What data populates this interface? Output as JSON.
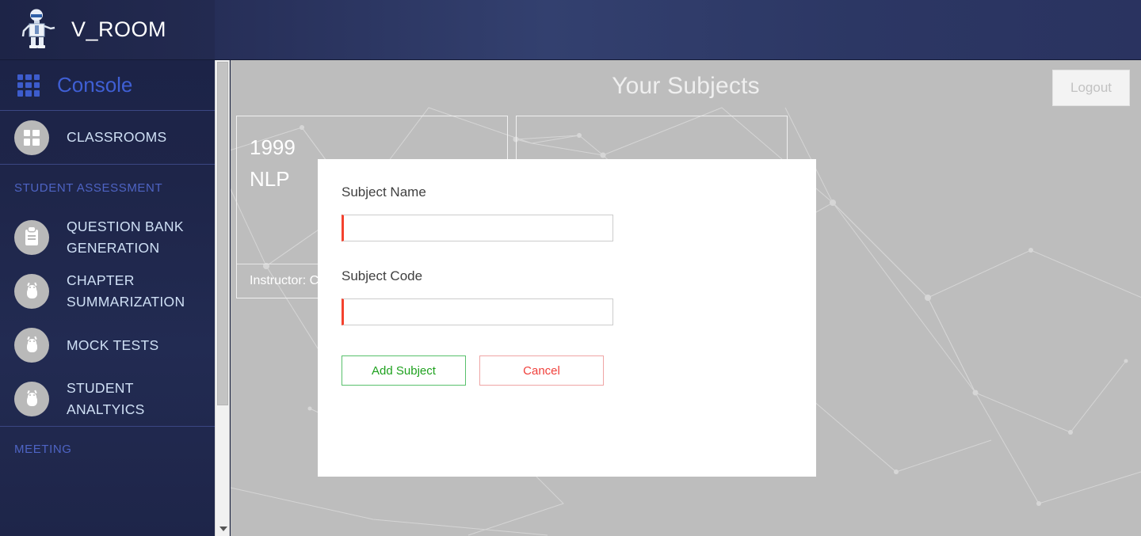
{
  "header": {
    "brand_title": "V_ROOM",
    "logo_icon": "robot-icon"
  },
  "sidebar": {
    "console": {
      "label": "Console",
      "icon": "grid-apps-icon"
    },
    "items": [
      {
        "label": "CLASSROOMS",
        "icon": "dashboard-icon"
      },
      {
        "label": "QUESTION BANK GENERATION",
        "icon": "clipboard-icon"
      },
      {
        "label": "CHAPTER SUMMARIZATION",
        "icon": "bot-icon"
      },
      {
        "label": "MOCK TESTS",
        "icon": "bot-icon"
      },
      {
        "label": "STUDENT ANALTYICS",
        "icon": "bot-icon"
      }
    ],
    "sections": {
      "student_assessment": "STUDENT ASSESSMENT",
      "meeting": "MEETING"
    },
    "scrollbar": {
      "down_arrow_icon": "chevron-down-icon"
    }
  },
  "main": {
    "page_title": "Your Subjects",
    "logout_label": "Logout",
    "cards": [
      {
        "year": "1999",
        "name": "NLP",
        "instructor": "Instructor: Ca"
      },
      {
        "year": "",
        "name": "",
        "instructor": ""
      }
    ]
  },
  "modal": {
    "subject_name_label": "Subject Name",
    "subject_name_value": "",
    "subject_name_placeholder": "",
    "subject_code_label": "Subject Code",
    "subject_code_value": "",
    "subject_code_placeholder": "",
    "add_label": "Add Subject",
    "cancel_label": "Cancel"
  },
  "colors": {
    "brand_navy": "#1e2549",
    "header_navy": "#33406f",
    "console_blue": "#3f5fd4",
    "nav_label": "#cfe0f5",
    "section_label": "#4e64c4",
    "content_gray": "#bdbdbd",
    "input_accent_red": "#f4422e",
    "add_green": "#1ea11e",
    "cancel_red": "#f0403b"
  }
}
